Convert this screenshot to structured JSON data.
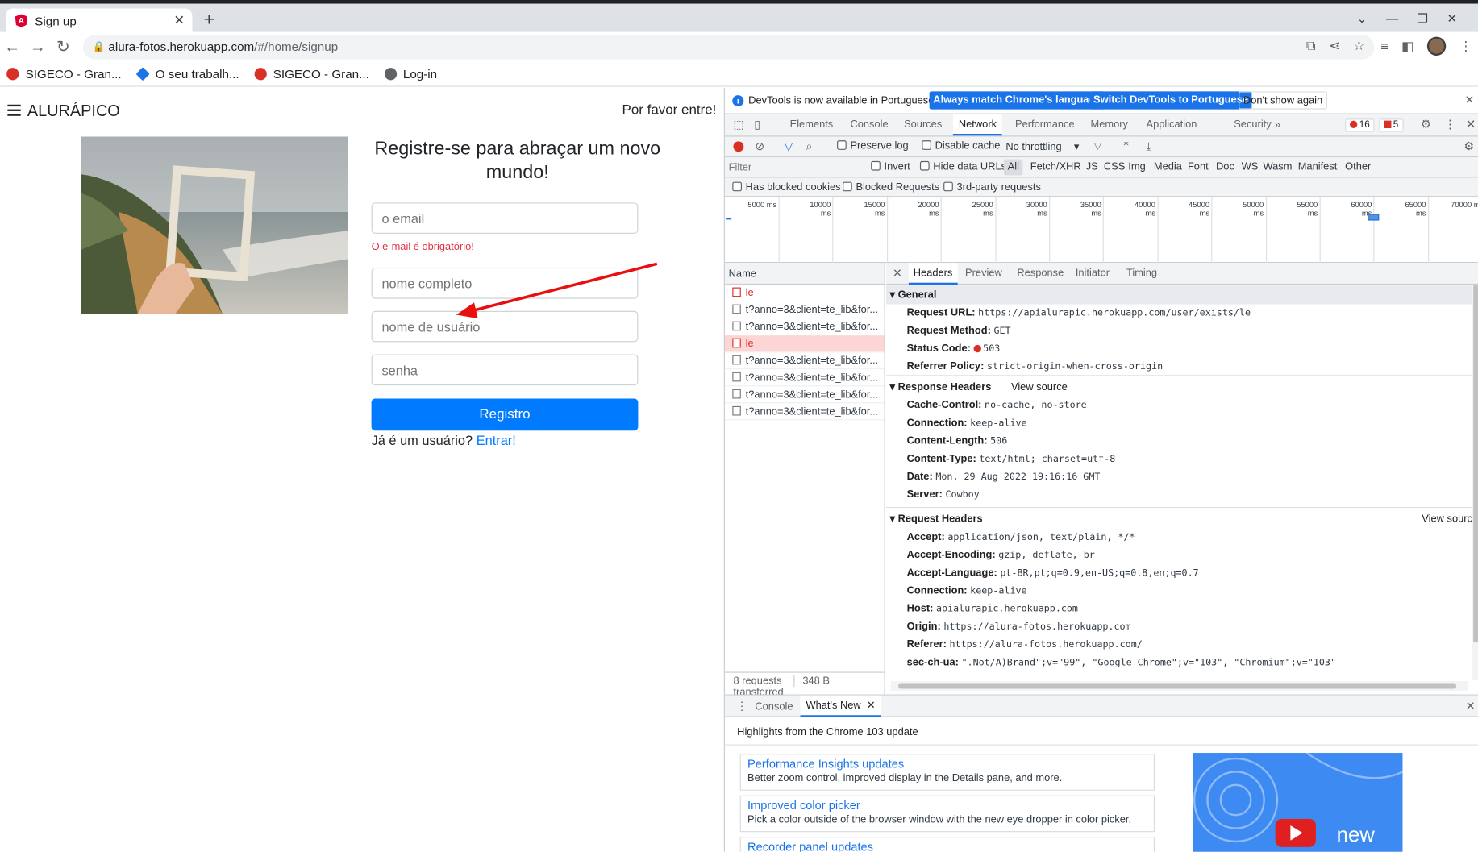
{
  "browser": {
    "tab_title": "Sign up",
    "url_host": "alura-fotos.herokuapp.com",
    "url_path": "/#/home/signup",
    "bookmarks": [
      {
        "label": "SIGECO - Gran...",
        "color": "#d93025"
      },
      {
        "label": "O seu trabalh...",
        "color": "#1a73e8"
      },
      {
        "label": "SIGECO - Gran...",
        "color": "#d93025"
      },
      {
        "label": "Log-in",
        "color": "#5f6368"
      }
    ]
  },
  "page": {
    "brand": "ALURÁPICO",
    "please": "Por favor entre!",
    "heading": "Registre-se para abraçar um novo mundo!",
    "email_placeholder": "o email",
    "email_error": "O e-mail é obrigatório!",
    "fullname_placeholder": "nome completo",
    "username_placeholder": "nome de usuário",
    "password_placeholder": "senha",
    "register_label": "Registro",
    "already_text": "Já é um usuário?",
    "login_link": "Entrar!"
  },
  "devtools": {
    "infobar": {
      "message": "DevTools is now available in Portuguese!",
      "btn_match": "Always match Chrome's language",
      "btn_switch": "Switch DevTools to Portuguese",
      "btn_dont": "Don't show again"
    },
    "tabs": [
      "Elements",
      "Console",
      "Sources",
      "Network",
      "Performance",
      "Memory",
      "Application",
      "Security"
    ],
    "active_tab": "Network",
    "error_count": "16",
    "issue_count": "5",
    "toolbar": {
      "preserve_log": "Preserve log",
      "disable_cache": "Disable cache",
      "throttling": "No throttling"
    },
    "filter": {
      "placeholder": "Filter",
      "invert": "Invert",
      "hide_data_urls": "Hide data URLs",
      "types": [
        "All",
        "Fetch/XHR",
        "JS",
        "CSS",
        "Img",
        "Media",
        "Font",
        "Doc",
        "WS",
        "Wasm",
        "Manifest",
        "Other"
      ],
      "has_blocked_cookies": "Has blocked cookies",
      "blocked_requests": "Blocked Requests",
      "third_party": "3rd-party requests"
    },
    "timeline_ticks": [
      "5000 ms",
      "10000 ms",
      "15000 ms",
      "20000 ms",
      "25000 ms",
      "30000 ms",
      "35000 ms",
      "40000 ms",
      "45000 ms",
      "50000 ms",
      "55000 ms",
      "60000 ms",
      "65000 ms",
      "70000 m"
    ],
    "name_header": "Name",
    "requests": [
      {
        "name": "le",
        "error": true,
        "selected": false
      },
      {
        "name": "t?anno=3&client=te_lib&for...",
        "error": false,
        "selected": false
      },
      {
        "name": "t?anno=3&client=te_lib&for...",
        "error": false,
        "selected": false
      },
      {
        "name": "le",
        "error": true,
        "selected": true
      },
      {
        "name": "t?anno=3&client=te_lib&for...",
        "error": false,
        "selected": false
      },
      {
        "name": "t?anno=3&client=te_lib&for...",
        "error": false,
        "selected": false
      },
      {
        "name": "t?anno=3&client=te_lib&for...",
        "error": false,
        "selected": false
      },
      {
        "name": "t?anno=3&client=te_lib&for...",
        "error": false,
        "selected": false
      }
    ],
    "summary": {
      "requests": "8 requests",
      "transferred": "348 B transferred"
    },
    "detail_tabs": [
      "Headers",
      "Preview",
      "Response",
      "Initiator",
      "Timing"
    ],
    "general": {
      "title": "General",
      "rows": [
        {
          "k": "Request URL:",
          "v": "https://apialurapic.herokuapp.com/user/exists/le"
        },
        {
          "k": "Request Method:",
          "v": "GET"
        },
        {
          "k": "Status Code:",
          "v": "503"
        },
        {
          "k": "Referrer Policy:",
          "v": "strict-origin-when-cross-origin"
        }
      ]
    },
    "response_headers": {
      "title": "Response Headers",
      "view_source": "View source",
      "rows": [
        {
          "k": "Cache-Control:",
          "v": "no-cache, no-store"
        },
        {
          "k": "Connection:",
          "v": "keep-alive"
        },
        {
          "k": "Content-Length:",
          "v": "506"
        },
        {
          "k": "Content-Type:",
          "v": "text/html; charset=utf-8"
        },
        {
          "k": "Date:",
          "v": "Mon, 29 Aug 2022 19:16:16 GMT"
        },
        {
          "k": "Server:",
          "v": "Cowboy"
        }
      ]
    },
    "request_headers": {
      "title": "Request Headers",
      "view_source": "View sourc",
      "rows": [
        {
          "k": "Accept:",
          "v": "application/json, text/plain, */*"
        },
        {
          "k": "Accept-Encoding:",
          "v": "gzip, deflate, br"
        },
        {
          "k": "Accept-Language:",
          "v": "pt-BR,pt;q=0.9,en-US;q=0.8,en;q=0.7"
        },
        {
          "k": "Connection:",
          "v": "keep-alive"
        },
        {
          "k": "Host:",
          "v": "apialurapic.herokuapp.com"
        },
        {
          "k": "Origin:",
          "v": "https://alura-fotos.herokuapp.com"
        },
        {
          "k": "Referer:",
          "v": "https://alura-fotos.herokuapp.com/"
        },
        {
          "k": "sec-ch-ua:",
          "v": "\".Not/A)Brand\";v=\"99\", \"Google Chrome\";v=\"103\", \"Chromium\";v=\"103\""
        }
      ]
    },
    "drawer": {
      "tab_console": "Console",
      "tab_whats_new": "What's New",
      "highlights": "Highlights from the Chrome 103 update",
      "cards": [
        {
          "title": "Performance Insights updates",
          "desc": "Better zoom control, improved display in the Details pane, and more."
        },
        {
          "title": "Improved color picker",
          "desc": "Pick a color outside of the browser window with the new eye dropper in color picker."
        },
        {
          "title": "Recorder panel updates",
          "desc": ""
        }
      ],
      "promo_text": "new"
    }
  }
}
